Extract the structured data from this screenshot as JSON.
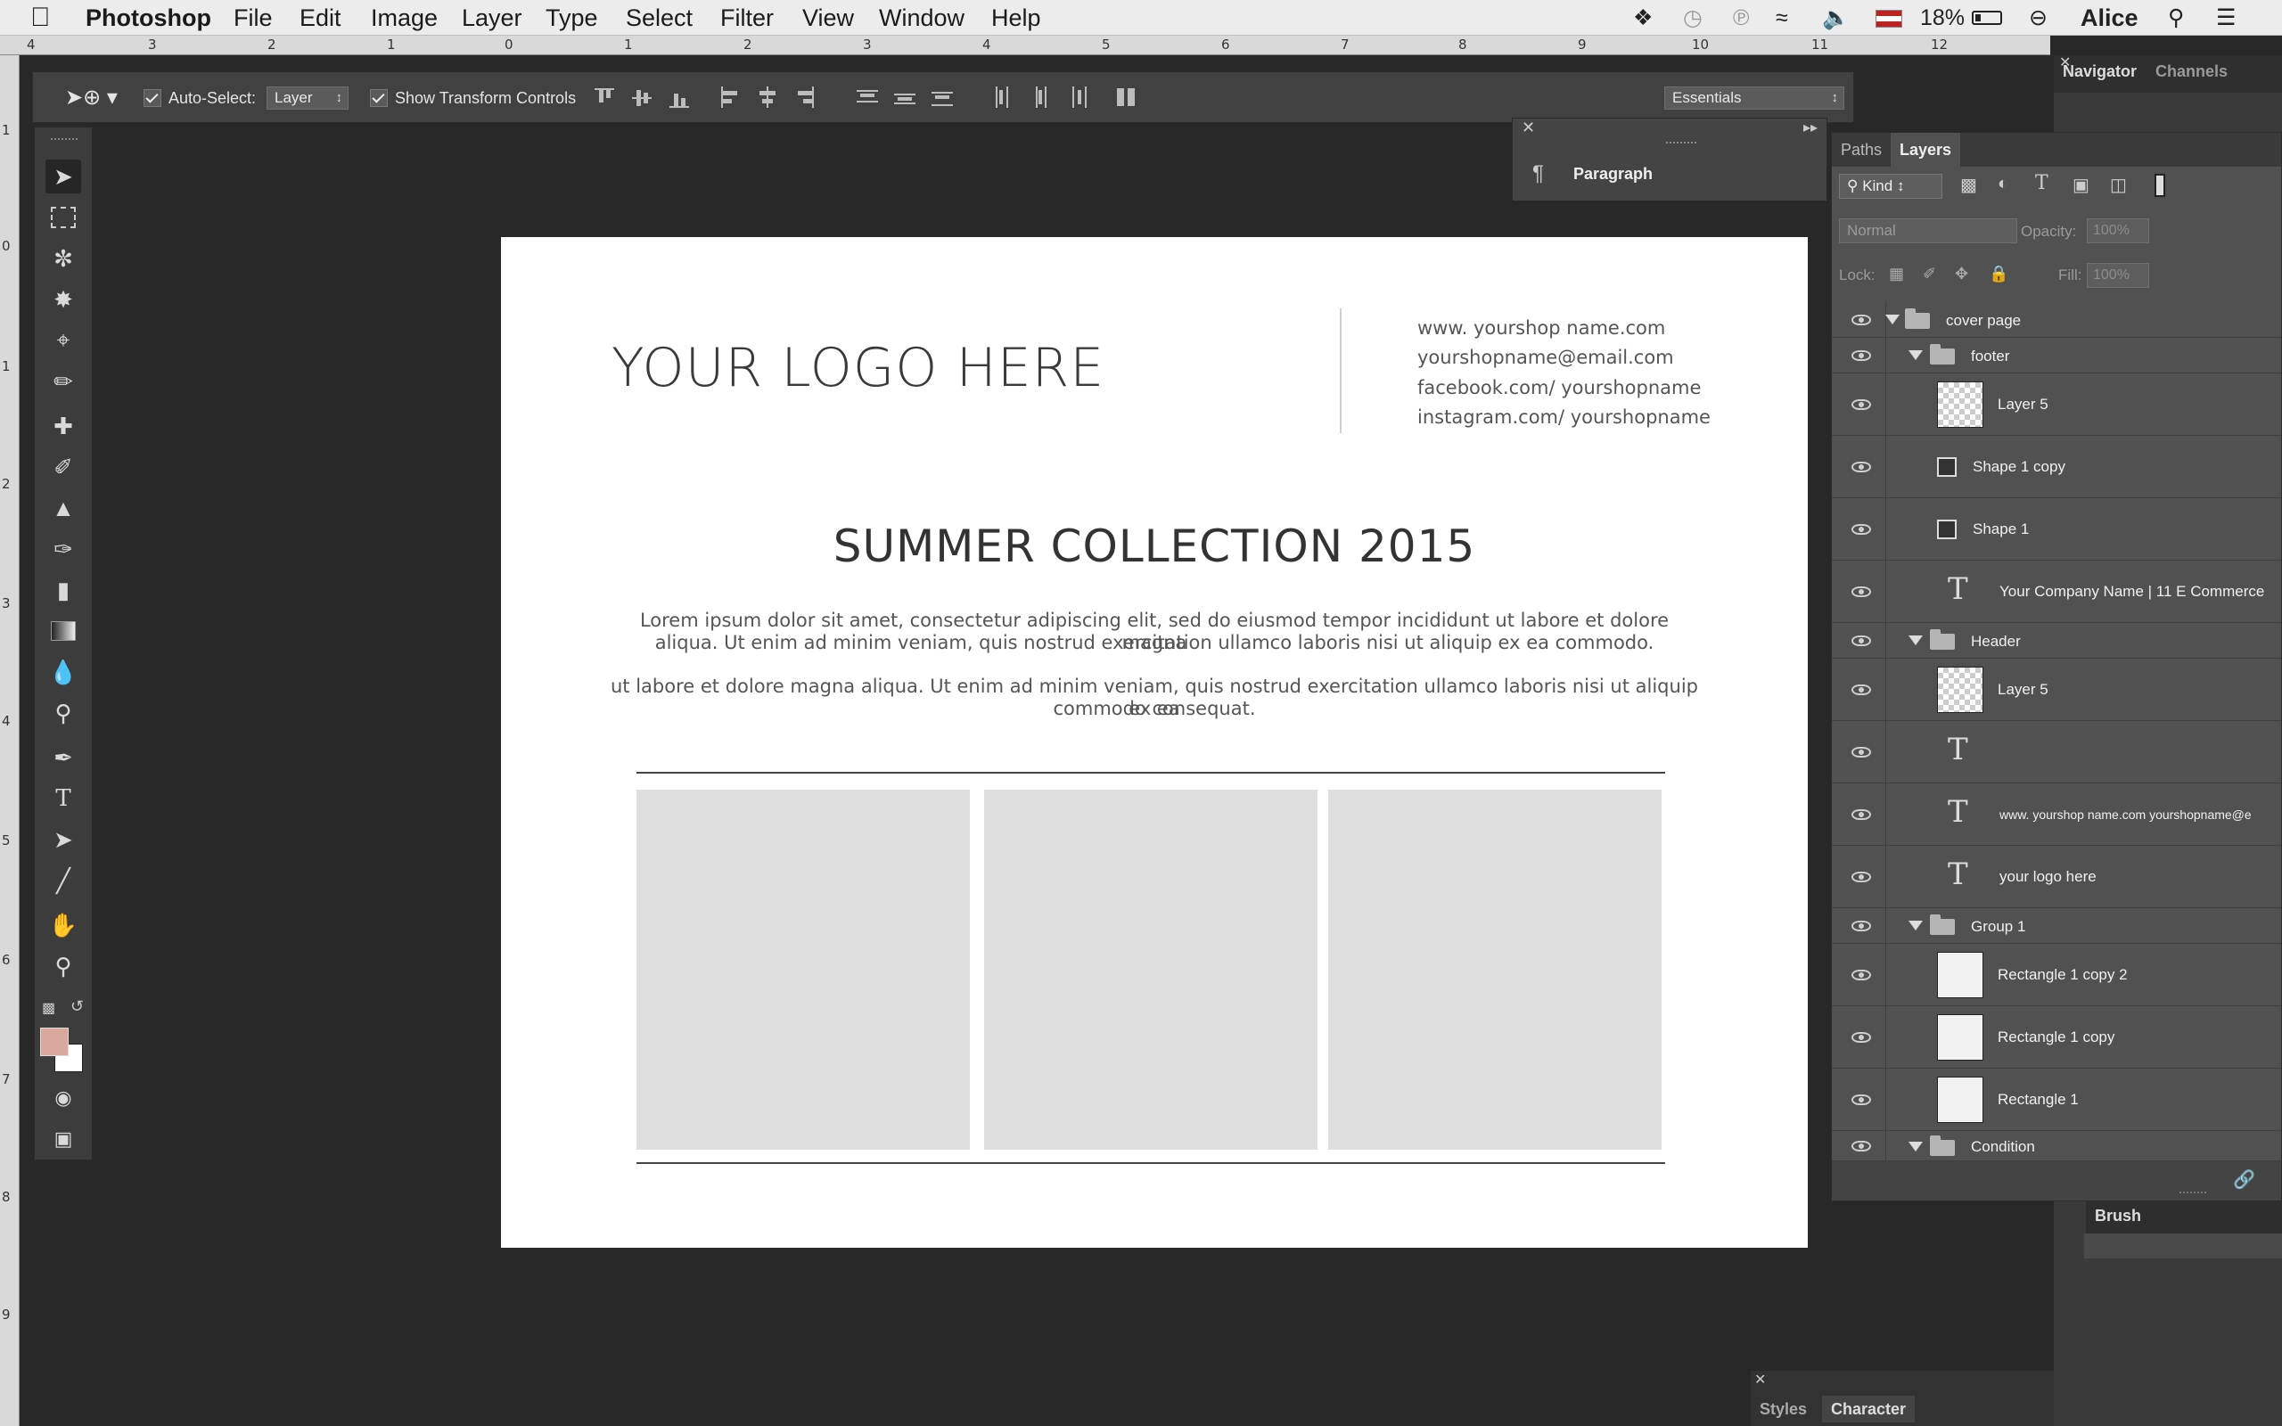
{
  "menubar": {
    "app": "Photoshop",
    "items": [
      "File",
      "Edit",
      "Image",
      "Layer",
      "Type",
      "Select",
      "Filter",
      "View",
      "Window",
      "Help"
    ],
    "battery": "18%",
    "user": "Alice"
  },
  "ruler": {
    "h_numbers": [
      "4",
      "3",
      "2",
      "1",
      "0",
      "1",
      "2",
      "3",
      "4",
      "5",
      "6",
      "7",
      "8",
      "9",
      "10",
      "11",
      "12"
    ],
    "v_numbers": [
      "1",
      "0",
      "1",
      "2",
      "3",
      "4",
      "5",
      "6",
      "7",
      "8",
      "9"
    ]
  },
  "options": {
    "auto_select_label": "Auto-Select:",
    "auto_select_value": "Layer",
    "transform_label": "Show Transform Controls",
    "workspace": "Essentials"
  },
  "tools": [
    "move",
    "marquee",
    "lasso",
    "magic-wand",
    "crop",
    "eyedropper",
    "healing",
    "brush",
    "stamp",
    "history-brush",
    "eraser",
    "gradient",
    "blur",
    "dodge",
    "pen",
    "type",
    "path-select",
    "line",
    "hand",
    "zoom"
  ],
  "colors": {
    "foreground": "#d9a99e",
    "background": "#ffffff"
  },
  "document": {
    "logo": "YOUR LOGO HERE",
    "contacts": [
      "www. yourshop name.com",
      "yourshopname@email.com",
      "facebook.com/ yourshopname",
      "instagram.com/ yourshopname"
    ],
    "title": "SUMMER COLLECTION 2015",
    "para1_line1": "Lorem ipsum dolor sit amet, consectetur adipiscing elit, sed do eiusmod tempor incididunt ut labore et dolore magna",
    "para1_line2": "aliqua. Ut enim ad minim veniam, quis nostrud exercitation ullamco laboris nisi ut aliquip ex ea commodo.",
    "para2_line1": "ut labore et dolore magna aliqua. Ut enim ad minim veniam, quis nostrud exercitation ullamco laboris nisi ut aliquip ex ea",
    "para2_line2": "commodo consequat."
  },
  "paragraph_panel": {
    "label": "Paragraph"
  },
  "layers_panel": {
    "tabs": [
      "Paths",
      "Layers"
    ],
    "filter_kind": "Kind",
    "blend_mode": "Normal",
    "opacity_label": "Opacity:",
    "opacity_value": "100%",
    "lock_label": "Lock:",
    "fill_label": "Fill:",
    "fill_value": "100%",
    "layers": [
      {
        "name": "cover page",
        "kind": "group"
      },
      {
        "name": "footer",
        "kind": "group"
      },
      {
        "name": "Layer 5",
        "kind": "pixel"
      },
      {
        "name": "Shape 1 copy",
        "kind": "shape"
      },
      {
        "name": "Shape 1",
        "kind": "shape"
      },
      {
        "name": "Your Company Name  |  11 E Commerce",
        "kind": "text"
      },
      {
        "name": "Header",
        "kind": "group"
      },
      {
        "name": "Layer 5",
        "kind": "pixel"
      },
      {
        "name": "",
        "kind": "text"
      },
      {
        "name": "www. yourshop name.com yourshopname@e",
        "kind": "text"
      },
      {
        "name": "your logo here",
        "kind": "text"
      },
      {
        "name": "Group 1",
        "kind": "group"
      },
      {
        "name": "Rectangle 1 copy 2",
        "kind": "rect"
      },
      {
        "name": "Rectangle 1 copy",
        "kind": "rect"
      },
      {
        "name": "Rectangle 1",
        "kind": "rect"
      },
      {
        "name": "Condition",
        "kind": "group"
      }
    ]
  },
  "right_dock": {
    "tabs": [
      "Navigator",
      "Channels"
    ],
    "brush_label": "Brush",
    "bottom_tabs": [
      "Styles",
      "Character"
    ]
  }
}
